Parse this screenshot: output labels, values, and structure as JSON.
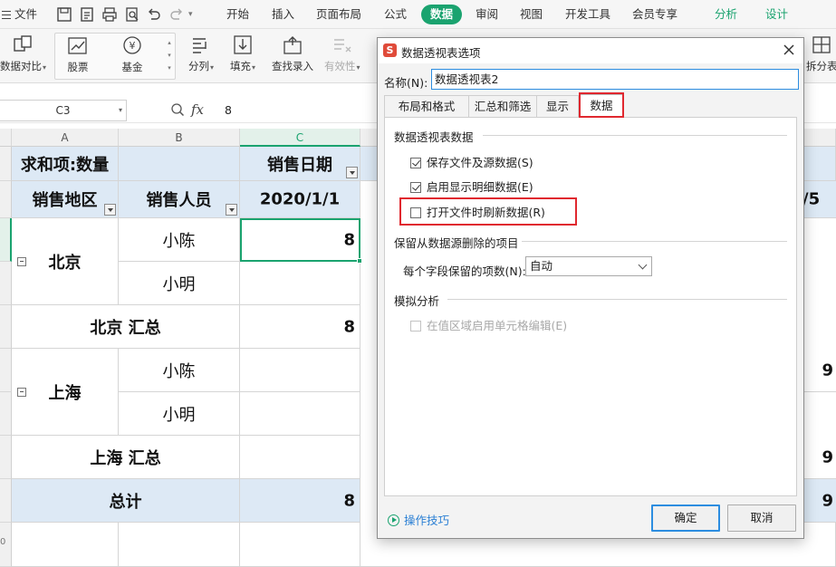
{
  "menubar": {
    "file": "文件",
    "tabs": [
      "开始",
      "插入",
      "页面布局",
      "公式",
      "数据",
      "审阅",
      "视图",
      "开发工具",
      "会员专享"
    ],
    "active_tab": "数据",
    "context_tabs": [
      "分析",
      "设计"
    ]
  },
  "ribbon": {
    "compare": "数据对比",
    "stock": "股票",
    "fund": "基金",
    "split": "分列",
    "fill": "填充",
    "lookup": "查找录入",
    "validity": "有效性",
    "split_table": "拆分表"
  },
  "formula_bar": {
    "cell_ref": "C3",
    "fx": "fx",
    "value": "8"
  },
  "sheet": {
    "columns": [
      "A",
      "B",
      "C"
    ],
    "row_numbers": [
      "0"
    ],
    "pivot_field_header": "求和项:数量",
    "date_field_header": "销售日期",
    "region_header": "销售地区",
    "person_header": "销售人员",
    "date_value": "2020/1/1",
    "region_beijing": "北京",
    "region_shanghai": "上海",
    "person_chen": "小陈",
    "person_ming": "小明",
    "beijing_total_label": "北京 汇总",
    "shanghai_total_label": "上海 汇总",
    "grand_total_label": "总计",
    "value_beijing_chen": "8",
    "value_beijing_total": "8",
    "value_grand_total": "8",
    "right_fragment_header": "/5",
    "right_fragment_values": [
      "9",
      "9",
      "9"
    ]
  },
  "dialog": {
    "title": "数据透视表选项",
    "name_label": "名称(N):",
    "name_value": "数据透视表2",
    "tabs": [
      "布局和格式",
      "汇总和筛选",
      "显示",
      "数据"
    ],
    "active_tab": "数据",
    "group_pivot_data": "数据透视表数据",
    "opt_save_source": "保存文件及源数据(S)",
    "opt_save_source_checked": true,
    "opt_enable_detail": "启用显示明细数据(E)",
    "opt_enable_detail_checked": true,
    "opt_refresh_on_open": "打开文件时刷新数据(R)",
    "opt_refresh_on_open_checked": false,
    "group_retain_items": "保留从数据源删除的项目",
    "items_per_field_label": "每个字段保留的项数(N):",
    "items_per_field_value": "自动",
    "group_whatif": "模拟分析",
    "opt_enable_edit": "在值区域启用单元格编辑(E)",
    "opt_enable_edit_checked": false,
    "tips_link": "操作技巧",
    "ok_button": "确定",
    "cancel_button": "取消"
  },
  "colors": {
    "accent_green": "#1aa36f",
    "pivot_header_blue": "#dde9f5",
    "highlight_red": "#e0282f",
    "dialog_focus_blue": "#2c8de0"
  }
}
